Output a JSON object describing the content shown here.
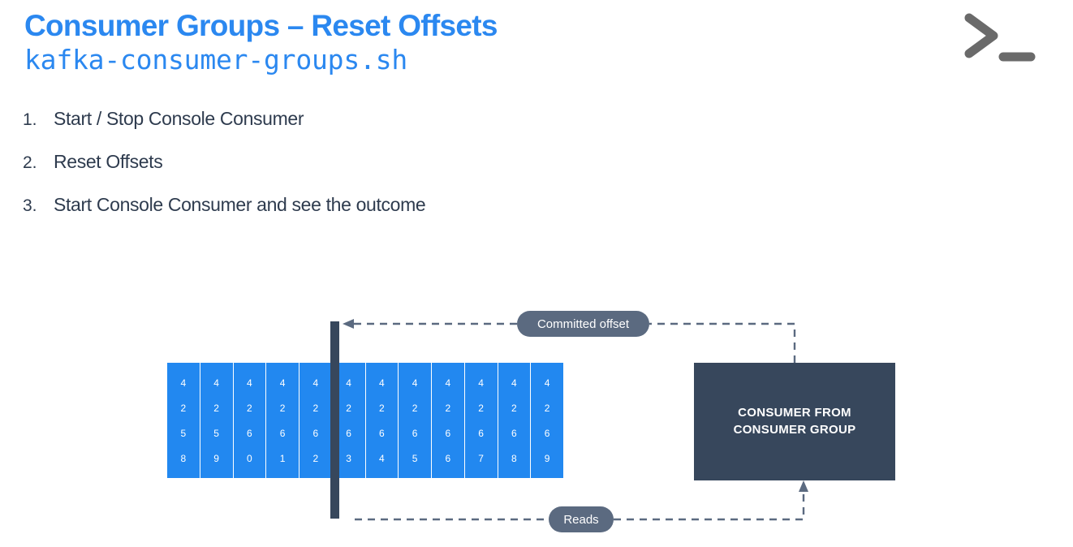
{
  "header": {
    "title": "Consumer Groups – Reset Offsets",
    "subtitle": "kafka-consumer-groups.sh",
    "title_color": "#2b88f0",
    "icon": "terminal-prompt-icon"
  },
  "steps": [
    {
      "number": "1.",
      "label": "Start / Stop Console Consumer"
    },
    {
      "number": "2.",
      "label": "Reset Offsets"
    },
    {
      "number": "3.",
      "label": "Start Console Consumer and see the outcome"
    }
  ],
  "diagram": {
    "partition_cells": [
      "4258",
      "4259",
      "4260",
      "4261",
      "4262",
      "4263",
      "4264",
      "4265",
      "4266",
      "4267",
      "4268",
      "4269"
    ],
    "cell_color": "#2288f0",
    "cell_text_color": "#ffffff",
    "offset_marker": {
      "name": "committed-offset-marker",
      "color": "#37475c",
      "after_cell_index": 5
    },
    "consumer_box": {
      "line1": "CONSUMER FROM",
      "line2": "CONSUMER GROUP",
      "color": "#37475c",
      "text_color": "#ffffff"
    },
    "labels": {
      "committed_offset": "Committed offset",
      "reads": "Reads"
    },
    "pill_color": "#5b6a80",
    "connector_color": "#5b6a80"
  }
}
